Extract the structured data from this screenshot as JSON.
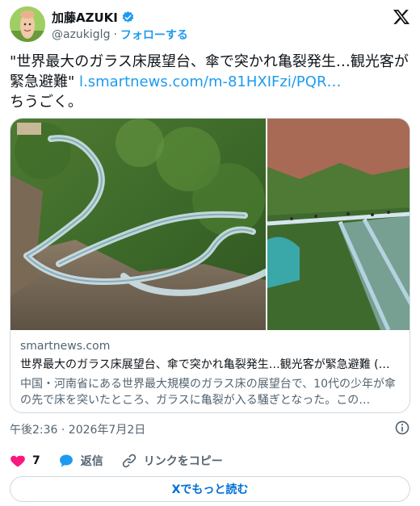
{
  "author": {
    "display_name": "加藤AZUKI",
    "handle": "@azukiglg",
    "separator": "·",
    "follow_label": "フォローする"
  },
  "tweet": {
    "text_before": "\"世界最大のガラス床展望台、傘で突かれ亀裂発生…観光客が緊急避難\" ",
    "link": "l.smartnews.com/m-81HXIFzi/PQR…",
    "text_after": "ちうごく。"
  },
  "card": {
    "domain": "smartnews.com",
    "title": "世界最大のガラス床展望台、傘で突かれ亀裂発生…観光客が緊急避難 (…",
    "description": "中国・河南省にある世界最大規模のガラス床の展望台で、10代の少年が傘の先で床を突いたところ、ガラスに亀裂が入る騒ぎとなった。この…"
  },
  "timestamp": "午後2:36 · 2026年7月2日",
  "actions": {
    "like_count": "7",
    "reply_label": "返信",
    "copy_link_label": "リンクをコピー"
  },
  "read_more_label": "Xでもっと読む",
  "colors": {
    "accent": "#1d9bf0",
    "like": "#f91880",
    "text_secondary": "#536471",
    "border": "#cfd9de"
  }
}
